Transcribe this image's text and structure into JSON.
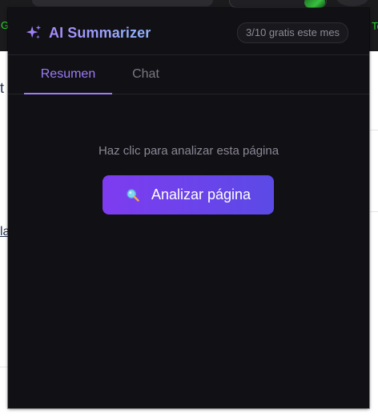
{
  "background_page": {
    "left_tab_text": "G",
    "right_tab_text": "To",
    "left_heading_fragment": "t",
    "left_link_fragment": "la"
  },
  "popup": {
    "header": {
      "icon": "sparkle-icon",
      "title": "AI Summarizer",
      "usage_badge": "3/10 gratis este mes"
    },
    "tabs": [
      {
        "label": "Resumen",
        "active": true
      },
      {
        "label": "Chat",
        "active": false
      }
    ],
    "main": {
      "hint": "Haz clic para analizar esta página",
      "analyze_button": {
        "icon": "magnifier-icon",
        "label": "Analizar página"
      }
    }
  },
  "colors": {
    "popup_background": "#111014",
    "accent": "#9d7cf8",
    "button_gradient_start": "#7e3cf0",
    "button_gradient_end": "#5b4ae6",
    "muted_text": "#8b8796",
    "background_green_text": "#29d629"
  }
}
